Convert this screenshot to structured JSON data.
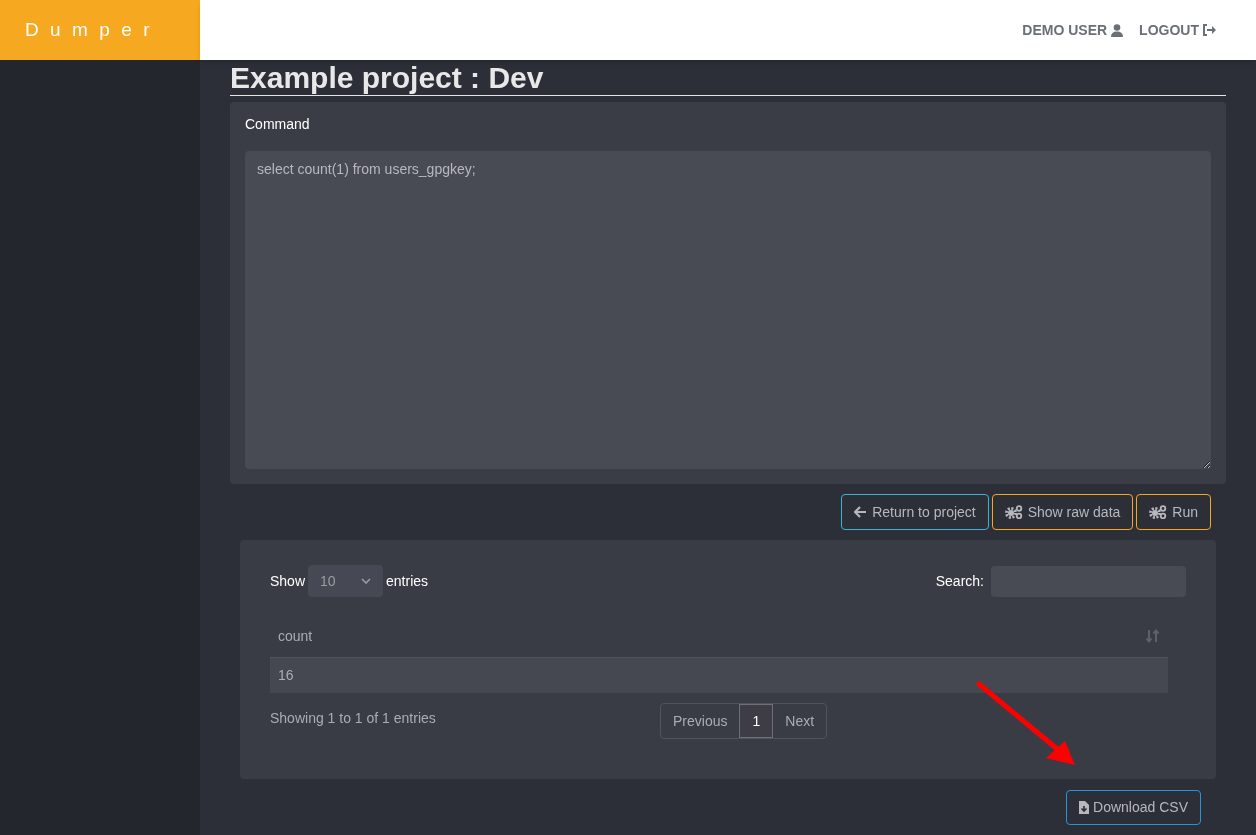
{
  "logo": "Dumper",
  "header": {
    "user": "DEMO USER",
    "logout": "LOGOUT"
  },
  "page_title": "Example project : Dev",
  "command": {
    "label": "Command",
    "value": "select count(1) from users_gpgkey;"
  },
  "actions": [
    {
      "label": "Return to project",
      "kind": "back"
    },
    {
      "label": "Show raw data",
      "kind": "gears"
    },
    {
      "label": "Run",
      "kind": "gears"
    }
  ],
  "table": {
    "length_prefix": "Show",
    "length_value": "10",
    "length_suffix": "entries",
    "search_label": "Search:",
    "columns": [
      "count"
    ],
    "rows": [
      [
        "16"
      ]
    ],
    "info": "Showing 1 to 1 of 1 entries",
    "pages": [
      {
        "label": "Previous",
        "selected": false
      },
      {
        "label": "1",
        "selected": true
      },
      {
        "label": "Next",
        "selected": false
      }
    ]
  },
  "download": "Download CSV"
}
